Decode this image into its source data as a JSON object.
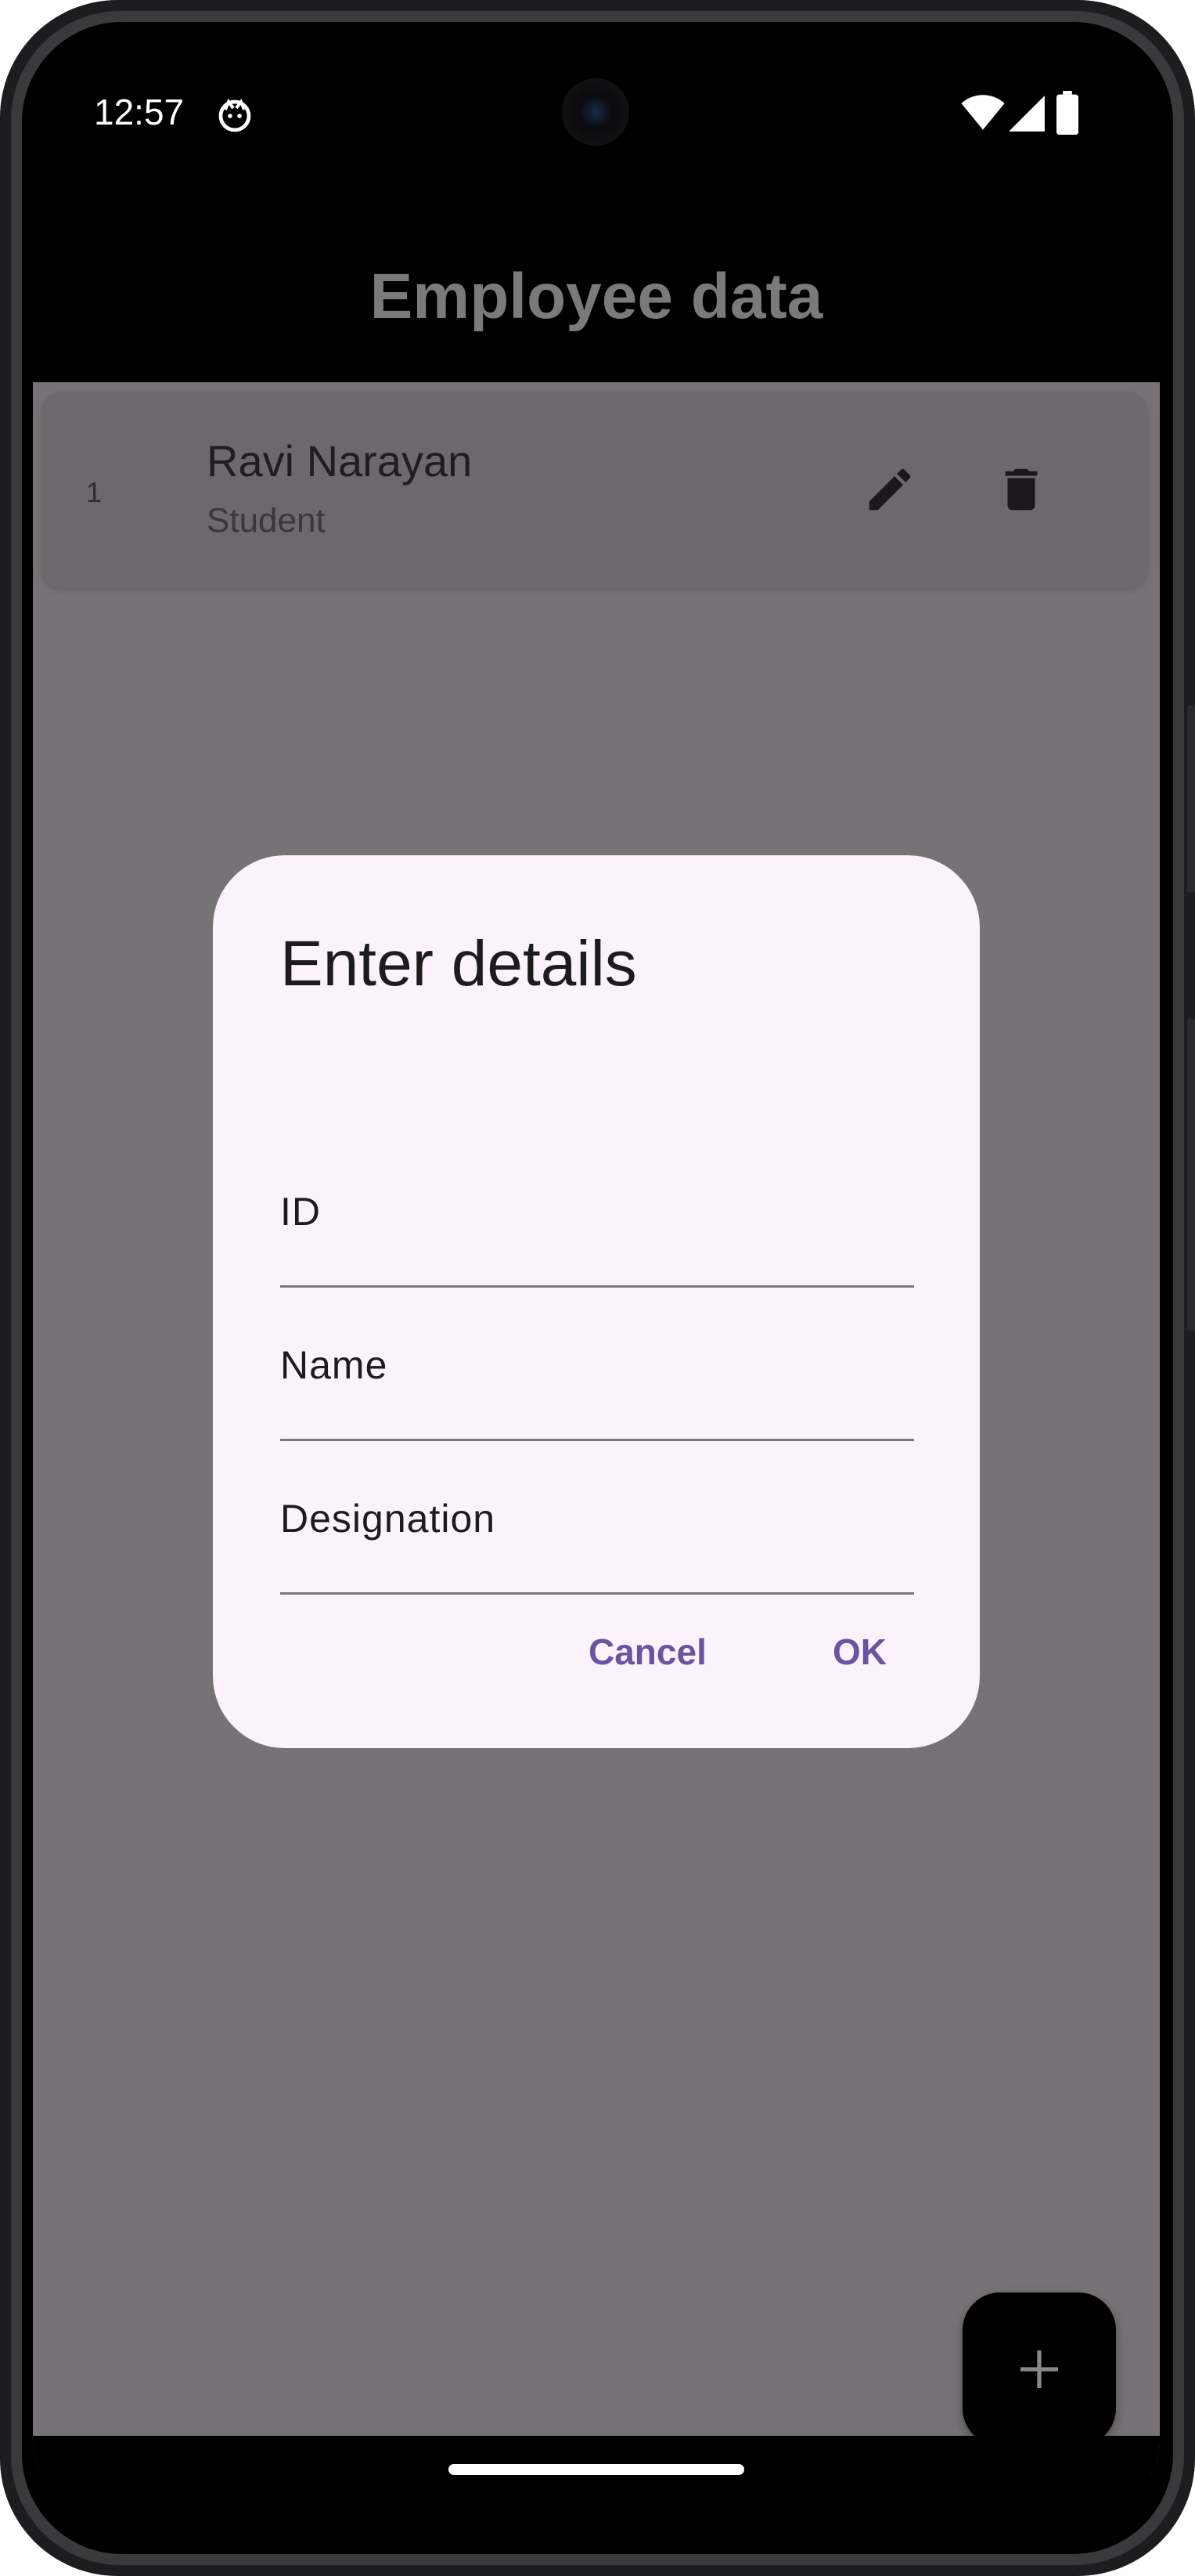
{
  "status_bar": {
    "time": "12:57",
    "icons": [
      "notification-app-icon",
      "wifi-icon",
      "signal-icon",
      "battery-icon"
    ]
  },
  "app_bar": {
    "title": "Employee data"
  },
  "employees": [
    {
      "id": "1",
      "name": "Ravi Narayan",
      "designation": "Student"
    }
  ],
  "list_item_actions": [
    "edit-icon",
    "delete-icon"
  ],
  "fab": {
    "icon": "add-icon"
  },
  "dialog": {
    "title": "Enter details",
    "fields": [
      {
        "label": "ID",
        "value": ""
      },
      {
        "label": "Name",
        "value": ""
      },
      {
        "label": "Designation",
        "value": ""
      }
    ],
    "cancel_label": "Cancel",
    "ok_label": "OK"
  },
  "colors": {
    "scrim": "#767275",
    "dialog_bg": "#fcf2fb",
    "accent": "#6a53a0",
    "app_bar_bg": "#000000"
  }
}
